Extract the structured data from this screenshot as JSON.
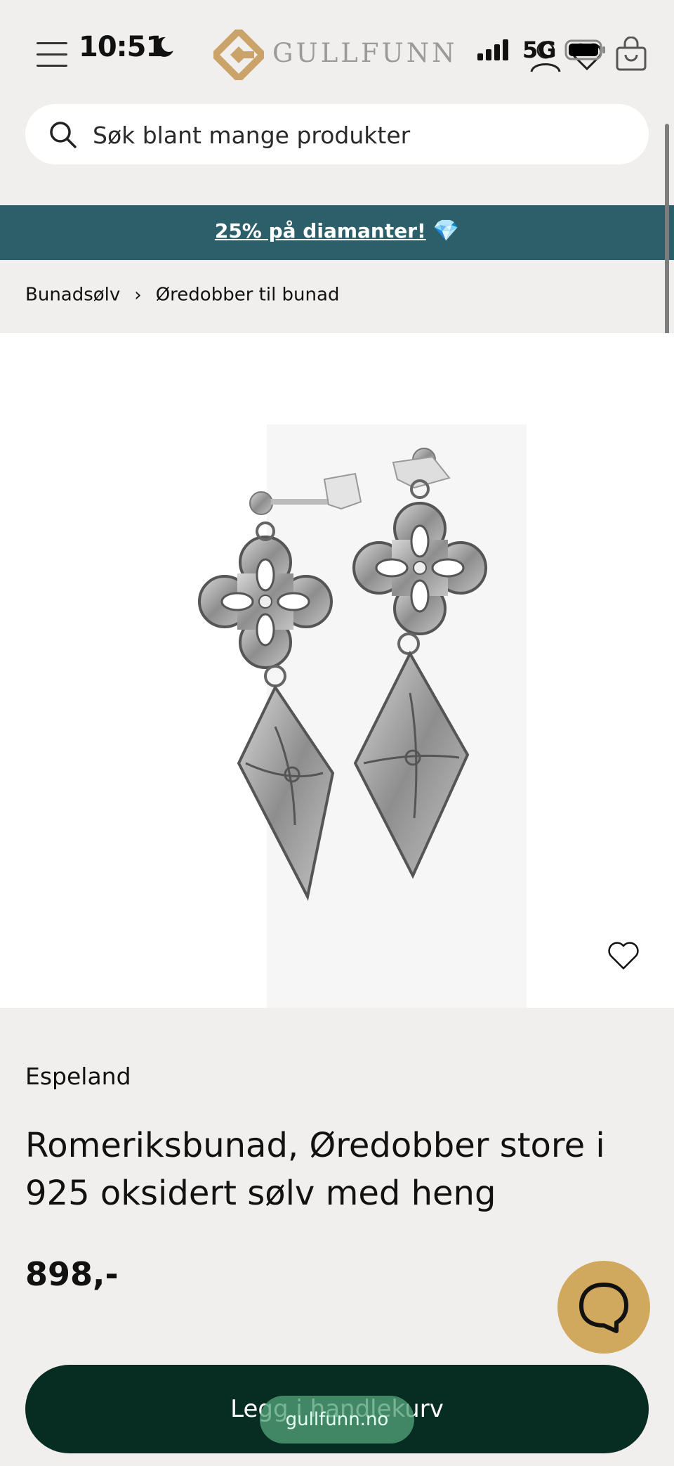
{
  "status_bar": {
    "time": "10:51",
    "network": "5G"
  },
  "header": {
    "logo_text": "GULLFUNN"
  },
  "search": {
    "placeholder": "Søk blant mange produkter"
  },
  "promo": {
    "text": "25% på diamanter!",
    "emoji": "💎"
  },
  "breadcrumb": {
    "items": [
      "Bunadsølv",
      "Øredobber til bunad"
    ]
  },
  "product": {
    "brand": "Espeland",
    "title": "Romeriksbunad, Øredobber store i 925 oksidert sølv med heng",
    "price": "898,-",
    "add_to_cart": "Legg i handlekurv"
  },
  "browser": {
    "url": "gullfunn.no"
  },
  "colors": {
    "promo_bg": "#2d5f6b",
    "cart_button": "#072d22",
    "chat_button": "#d1a95e",
    "logo_gold": "#c9a36a"
  }
}
